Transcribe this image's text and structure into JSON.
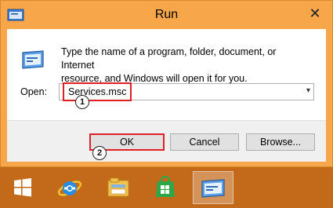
{
  "window": {
    "title": "Run",
    "close_glyph": "✕",
    "icon": "run-icon"
  },
  "dialog": {
    "description_line1": "Type the name of a program, folder, document, or Internet",
    "description_line2": "resource, and Windows will open it for you.",
    "open_label": "Open:",
    "open_value": "Services.msc",
    "dropdown_glyph": "▾",
    "buttons": {
      "ok": "OK",
      "cancel": "Cancel",
      "browse": "Browse..."
    }
  },
  "annotations": {
    "step1": "1",
    "step2": "2",
    "highlight_color": "#e02025"
  },
  "taskbar": {
    "items": [
      "windows-start-icon",
      "internet-explorer-icon",
      "file-explorer-icon",
      "windows-store-icon",
      "run-icon"
    ],
    "active_item": "run-icon"
  },
  "colors": {
    "title_bar": "#f7a64a",
    "taskbar": "#c26a19"
  }
}
